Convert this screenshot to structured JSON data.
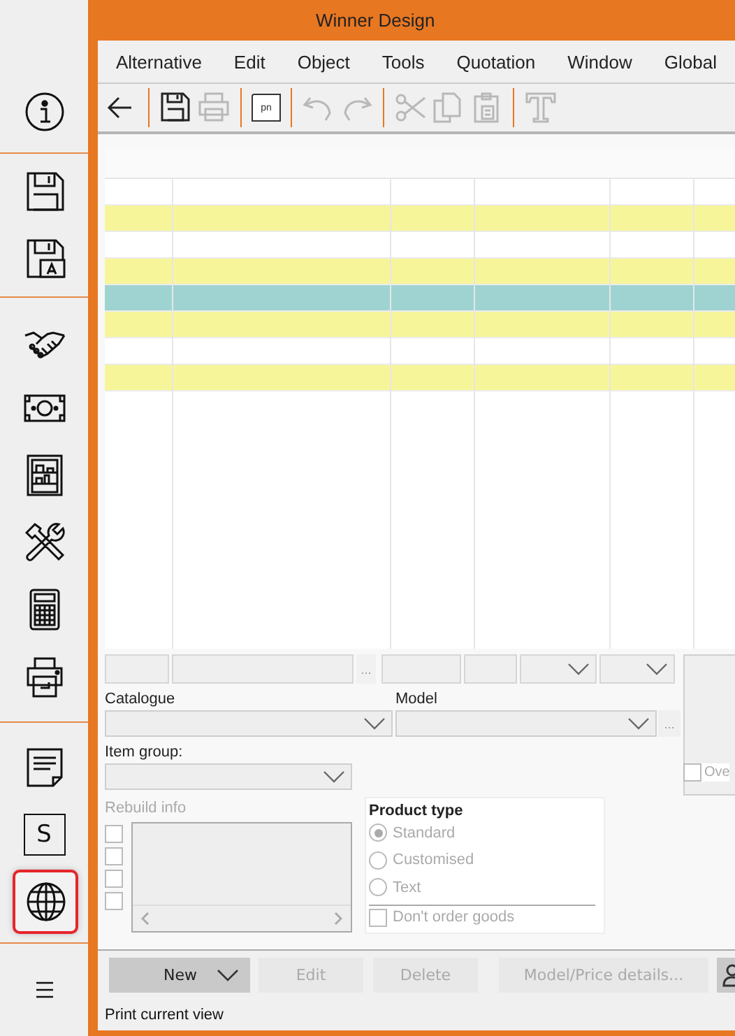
{
  "window": {
    "title": "Winner Design"
  },
  "sidebar": {
    "groups": [
      [
        {
          "kind": "info",
          "selected": false
        }
      ],
      [
        {
          "kind": "save",
          "selected": false
        },
        {
          "kind": "saveas",
          "selected": false
        }
      ],
      [
        {
          "kind": "deal",
          "selected": false
        },
        {
          "kind": "money",
          "selected": false
        },
        {
          "kind": "shelf",
          "selected": false
        },
        {
          "kind": "tools",
          "selected": false
        },
        {
          "kind": "calculator",
          "selected": false
        },
        {
          "kind": "printer",
          "selected": false
        }
      ],
      [
        {
          "kind": "note",
          "selected": false
        },
        {
          "kind": "letter",
          "label": "S",
          "selected": false
        },
        {
          "kind": "globe",
          "selected": true
        }
      ]
    ]
  },
  "menu": [
    "Alternative",
    "Edit",
    "Object",
    "Tools",
    "Quotation",
    "Window",
    "Global"
  ],
  "toolbar": [
    [
      {
        "kind": "back",
        "disabled": false
      }
    ],
    [
      {
        "kind": "save",
        "disabled": false
      },
      {
        "kind": "print",
        "disabled": true
      }
    ],
    [
      {
        "kind": "doc",
        "label": "pn",
        "disabled": false
      }
    ],
    [
      {
        "kind": "undo",
        "disabled": true
      },
      {
        "kind": "redo",
        "disabled": true
      }
    ],
    [
      {
        "kind": "cut",
        "disabled": true
      },
      {
        "kind": "copy",
        "disabled": true
      },
      {
        "kind": "paste",
        "disabled": true
      }
    ],
    [
      {
        "kind": "text",
        "disabled": true
      }
    ]
  ],
  "table": {
    "rows": [
      {
        "color": "#ffffff"
      },
      {
        "color": "#f7f59a"
      },
      {
        "color": "#ffffff"
      },
      {
        "color": "#f7f59a"
      },
      {
        "color": "#9fd3d1"
      },
      {
        "color": "#f7f59a"
      },
      {
        "color": "#ffffff"
      },
      {
        "color": "#f7f59a"
      }
    ]
  },
  "filter_fields": [
    {
      "kind": "text"
    },
    {
      "kind": "text"
    },
    {
      "kind": "ellipsis",
      "label": "..."
    },
    {
      "kind": "text"
    },
    {
      "kind": "text"
    },
    {
      "kind": "dropdown"
    },
    {
      "kind": "dropdown"
    }
  ],
  "catalogue": {
    "label": "Catalogue"
  },
  "model": {
    "label": "Model",
    "more": "..."
  },
  "item_group": {
    "label": "Item group:"
  },
  "override": {
    "label": "Ove",
    "checked": false
  },
  "rebuild_info": {
    "label": "Rebuild info",
    "disabled": true,
    "checkboxes": [
      {
        "checked": false
      },
      {
        "checked": false
      },
      {
        "checked": false
      },
      {
        "checked": false
      }
    ]
  },
  "product_type": {
    "title": "Product type",
    "disabled": true,
    "options": [
      {
        "label": "Standard",
        "selected": true
      },
      {
        "label": "Customised",
        "selected": false
      },
      {
        "label": "Text",
        "selected": false
      }
    ],
    "dont_order": {
      "label": "Don't order goods",
      "checked": false
    }
  },
  "buttons": [
    {
      "kind": "split",
      "label": "New",
      "disabled": false
    },
    {
      "kind": "plain",
      "label": "Edit",
      "disabled": true
    },
    {
      "kind": "plain",
      "label": "Delete",
      "disabled": true
    },
    {
      "kind": "plain",
      "label": "Model/Price details...",
      "disabled": true
    },
    {
      "kind": "user",
      "disabled": false
    }
  ],
  "status_bar": "Print current view"
}
